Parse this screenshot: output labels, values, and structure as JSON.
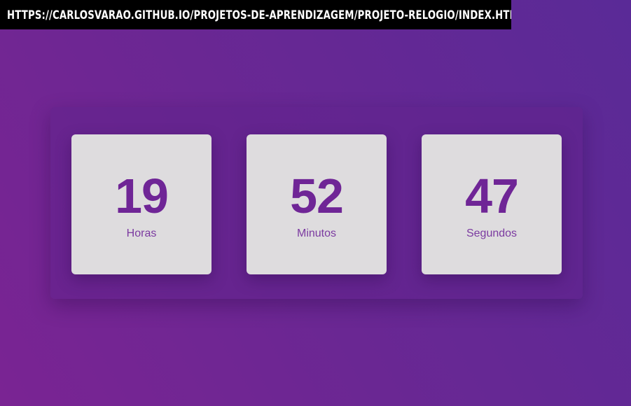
{
  "browser": {
    "url": "HTTPS://CARLOSVARAO.GITHUB.IO/PROJETOS-DE-APRENDIZAGEM/PROJETO-RELOGIO/INDEX.HTML"
  },
  "clock": {
    "hours": {
      "value": "19",
      "label": "Horas"
    },
    "minutes": {
      "value": "52",
      "label": "Minutos"
    },
    "seconds": {
      "value": "47",
      "label": "Segundos"
    }
  },
  "colors": {
    "background_start": "#7a2493",
    "background_end": "#5a2a97",
    "box_background": "#dedcde",
    "digit_color": "#6f2596",
    "label_color": "#7b3aa0",
    "url_bar_background": "#000000",
    "url_bar_text": "#ffffff"
  }
}
